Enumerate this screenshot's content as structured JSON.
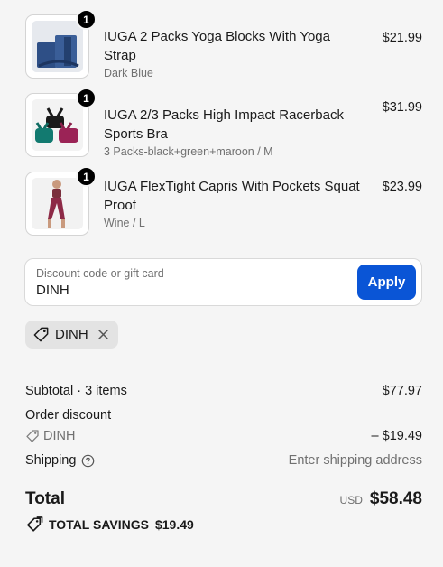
{
  "items": [
    {
      "title": "IUGA 2 Packs Yoga Blocks With Yoga Strap",
      "variant": "Dark Blue",
      "price": "$21.99",
      "quantity": "1"
    },
    {
      "title": "IUGA 2/3 Packs High Impact Racerback Sports Bra",
      "variant": "3 Packs-black+green+maroon / M",
      "price": "$31.99",
      "quantity": "1"
    },
    {
      "title": "IUGA FlexTight Capris With Pockets Squat Proof",
      "variant": "Wine / L",
      "price": "$23.99",
      "quantity": "1"
    }
  ],
  "discount": {
    "label": "Discount code or gift card",
    "value": "DINH",
    "apply_label": "Apply",
    "applied_code": "DINH"
  },
  "summary": {
    "subtotal_label": "Subtotal · 3 items",
    "subtotal_value": "$77.97",
    "order_discount_label": "Order discount",
    "discount_code": "DINH",
    "discount_value": "– $19.49",
    "shipping_label": "Shipping",
    "shipping_value": "Enter shipping address",
    "total_label": "Total",
    "currency": "USD",
    "total_value": "$58.48",
    "savings_label": "TOTAL SAVINGS",
    "savings_value": "$19.49"
  },
  "colors": {
    "accent": "#0a55d6",
    "badge": "#000000",
    "chip_bg": "#e3e3e3"
  }
}
